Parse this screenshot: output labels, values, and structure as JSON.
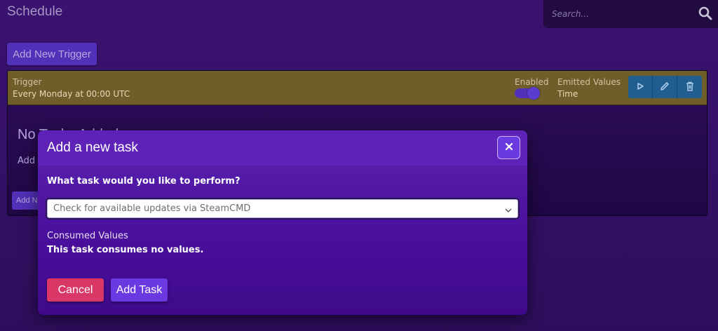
{
  "page": {
    "title": "Schedule"
  },
  "search": {
    "placeholder": "Search..."
  },
  "toolbar": {
    "add_trigger_label": "Add New Trigger"
  },
  "trigger": {
    "label": "Trigger",
    "value": "Every Monday at 00:00 UTC",
    "enabled_label": "Enabled",
    "enabled": true,
    "emitted_label": "Emitted Values",
    "emitted_value": "Time",
    "actions": [
      "play-icon",
      "pencil-icon",
      "trash-icon"
    ]
  },
  "tasks_area": {
    "no_tasks_text": "No Tasks Added",
    "add_text": "Add",
    "add_button_label": "Add N"
  },
  "modal": {
    "title": "Add a new task",
    "question": "What task would you like to perform?",
    "selected_task": "Check for available updates via SteamCMD",
    "consumed_label": "Consumed Values",
    "consumed_text": "This task consumes no values.",
    "cancel_label": "Cancel",
    "add_task_label": "Add Task"
  },
  "colors": {
    "background": "#3a1270",
    "trigger_header": "#6f5e2a",
    "primary": "#6a3ae0",
    "danger": "#d93766",
    "action_button": "#1f5e8e"
  }
}
